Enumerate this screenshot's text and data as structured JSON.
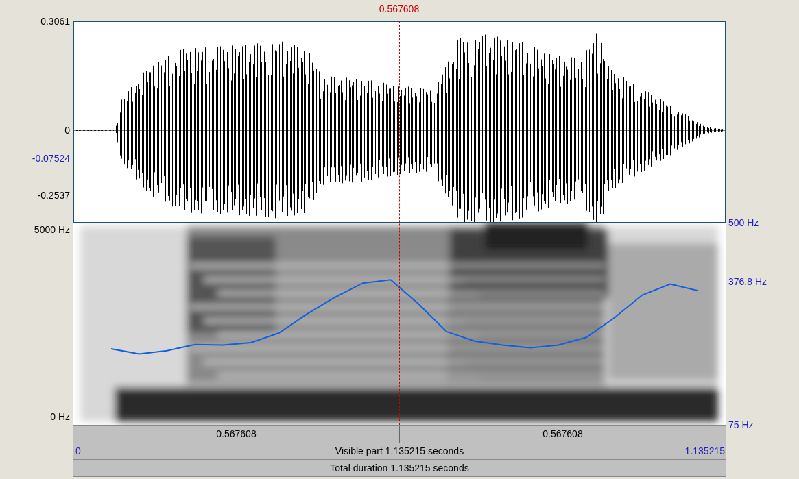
{
  "cursor": {
    "time": "0.567608"
  },
  "waveform": {
    "y_max": "0.3061",
    "y_zero": "0",
    "y_cursor": "-0.07524",
    "y_min": "-0.2537"
  },
  "spectrogram": {
    "f_max": "5000 Hz",
    "f_min": "0 Hz"
  },
  "pitch": {
    "chart_data": {
      "type": "line",
      "ylim": [
        75,
        500
      ],
      "yticks": [
        {
          "value": 500,
          "label": "500 Hz"
        },
        {
          "value": 376.8,
          "label": "376.8 Hz"
        },
        {
          "value": 75,
          "label": "75 Hz"
        }
      ],
      "categories": [
        null,
        null,
        null,
        null,
        null,
        null,
        null,
        null,
        null,
        null,
        null,
        null,
        null,
        null,
        null,
        null,
        null,
        null,
        null,
        null,
        null,
        null
      ],
      "series": [
        {
          "color": "#1060e0",
          "values": [
            235,
            224,
            231,
            244,
            243,
            248,
            268,
            308,
            343,
            373,
            380,
            329,
            271,
            251,
            243,
            237,
            243,
            259,
            300,
            348,
            371,
            357
          ]
        }
      ]
    }
  },
  "segments": [
    "0.567608",
    "0.567608"
  ],
  "visible_bar": {
    "start": "0",
    "label": "Visible part 1.135215 seconds",
    "end": "1.135215"
  },
  "total_bar": {
    "label": "Total duration 1.135215 seconds"
  }
}
